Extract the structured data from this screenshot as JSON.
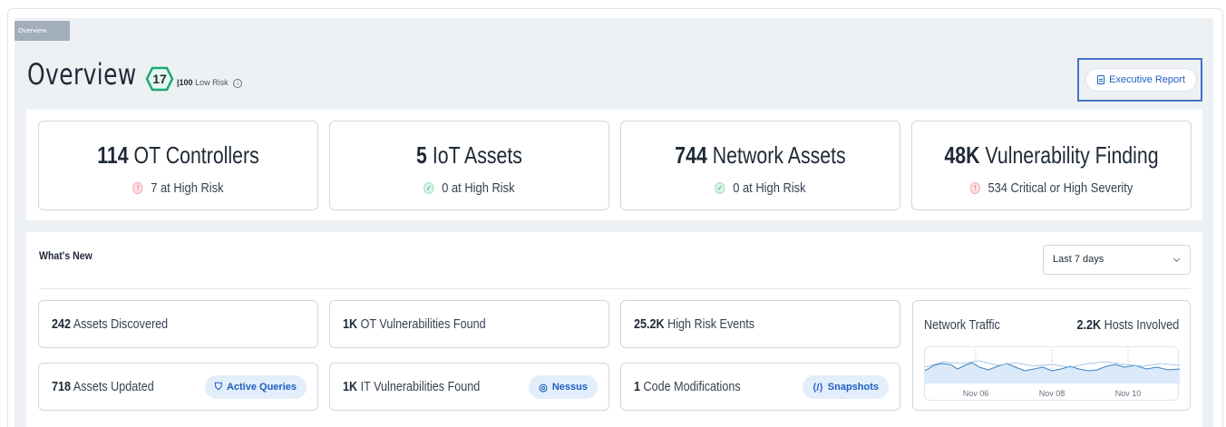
{
  "breadcrumb": "Overview",
  "header": {
    "title": "Overview",
    "score": "17",
    "score_max": "|100",
    "risk_label": "Low Risk",
    "exec_report_label": "Executive Report"
  },
  "summary_cards": [
    {
      "value": "114",
      "label": "OT Controllers",
      "sub": "7 at High Risk",
      "status": "red"
    },
    {
      "value": "5",
      "label": "IoT Assets",
      "sub": "0 at High Risk",
      "status": "green"
    },
    {
      "value": "744",
      "label": "Network Assets",
      "sub": "0 at High Risk",
      "status": "green"
    },
    {
      "value": "48K",
      "label": "Vulnerability Finding",
      "sub": "534 Critical or High Severity",
      "status": "red"
    }
  ],
  "whats_new": {
    "title": "What's New",
    "period_selected": "Last 7 days",
    "items": [
      {
        "value": "242",
        "label": "Assets Discovered"
      },
      {
        "value": "1K",
        "label": "OT Vulnerabilities Found"
      },
      {
        "value": "25.2K",
        "label": "High Risk Events"
      },
      {
        "value": "718",
        "label": "Assets Updated",
        "pill": "Active Queries"
      },
      {
        "value": "1K",
        "label": "IT Vulnerabilities Found",
        "pill": "Nessus"
      },
      {
        "value": "1",
        "label": "Code Modifications",
        "pill": "Snapshots"
      }
    ],
    "traffic": {
      "label": "Network Traffic",
      "hosts_value": "2.2K",
      "hosts_label": "Hosts Involved",
      "x_ticks": [
        "Nov 06",
        "Nov 08",
        "Nov 10"
      ]
    }
  },
  "colors": {
    "accent": "#1e5fbf",
    "score_green": "#19a974",
    "risk_red": "#d62e3c",
    "ok_green": "#1f9d6a"
  }
}
